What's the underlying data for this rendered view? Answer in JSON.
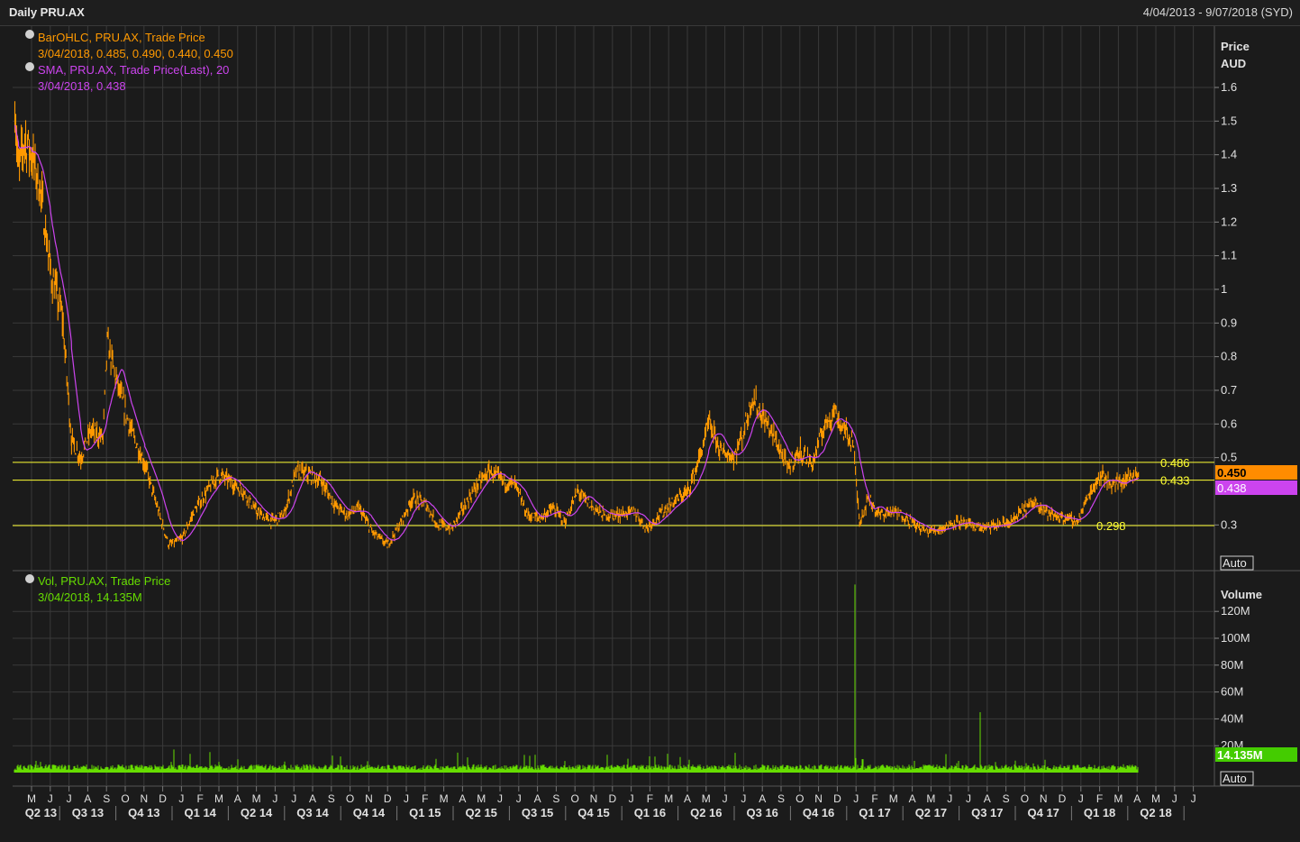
{
  "header": {
    "title": "Daily PRU.AX",
    "date_range": "4/04/2013 - 9/07/2018 (SYD)"
  },
  "legend": {
    "ohlc_name": "BarOHLC, PRU.AX, Trade Price",
    "ohlc_values": "3/04/2018, 0.485, 0.490, 0.440, 0.450",
    "sma_name": "SMA, PRU.AX, Trade Price(Last),  20",
    "sma_values": "3/04/2018, 0.438",
    "vol_name": "Vol, PRU.AX, Trade Price",
    "vol_values": "3/04/2018, 14.135M"
  },
  "price_axis": {
    "title_line1": "Price",
    "title_line2": "AUD",
    "ticks": [
      "1.6",
      "1.5",
      "1.4",
      "1.3",
      "1.2",
      "1.1",
      "1",
      "0.9",
      "0.8",
      "0.7",
      "0.6",
      "0.5",
      "0.3"
    ],
    "tick_values": [
      1.6,
      1.5,
      1.4,
      1.3,
      1.2,
      1.1,
      1.0,
      0.9,
      0.8,
      0.7,
      0.6,
      0.5,
      0.3
    ],
    "last_price": "0.450",
    "last_sma": "0.438",
    "auto_label": "Auto"
  },
  "volume_axis": {
    "title": "Volume",
    "ticks": [
      "120M",
      "100M",
      "80M",
      "60M",
      "40M",
      "20M"
    ],
    "tick_values": [
      120,
      100,
      80,
      60,
      40,
      20
    ],
    "last_volume": "14.135M",
    "auto_label": "Auto"
  },
  "levels": [
    {
      "label": "0.486",
      "value": 0.486
    },
    {
      "label": "0.433",
      "value": 0.433
    },
    {
      "label": "0.298",
      "value": 0.298
    }
  ],
  "x_axis": {
    "months": [
      "M",
      "J",
      "J",
      "A",
      "S",
      "O",
      "N",
      "D",
      "J",
      "F",
      "M",
      "A",
      "M",
      "J",
      "J",
      "A",
      "S",
      "O",
      "N",
      "D",
      "J",
      "F",
      "M",
      "A",
      "M",
      "J",
      "J",
      "A",
      "S",
      "O",
      "N",
      "D",
      "J",
      "F",
      "M",
      "A",
      "M",
      "J",
      "J",
      "A",
      "S",
      "O",
      "N",
      "D",
      "J",
      "F",
      "M",
      "A",
      "M",
      "J",
      "J",
      "A",
      "S",
      "O",
      "N",
      "D",
      "J",
      "F",
      "M",
      "A",
      "M",
      "J",
      "J"
    ],
    "quarters": [
      "Q2 13",
      "Q3 13",
      "Q4 13",
      "Q1 14",
      "Q2 14",
      "Q3 14",
      "Q4 14",
      "Q1 15",
      "Q2 15",
      "Q3 15",
      "Q4 15",
      "Q1 16",
      "Q2 16",
      "Q3 16",
      "Q4 16",
      "Q1 17",
      "Q2 17",
      "Q3 17",
      "Q4 17",
      "Q1 18",
      "Q2 18"
    ]
  },
  "colors": {
    "background": "#1b1b1b",
    "grid": "#3a3a3a",
    "price": "#ff9900",
    "sma": "#cc44ee",
    "volume": "#66dd00",
    "level": "#ffff33",
    "text": "#e0e0e0"
  },
  "chart_data": {
    "type": "line",
    "title": "Daily PRU.AX",
    "x_range": [
      "2013-04-04",
      "2018-07-09"
    ],
    "ylim": [
      0.2,
      1.7
    ],
    "price_series_name": "BarOHLC, PRU.AX, Trade Price",
    "sma_series_name": "SMA, PRU.AX, Trade Price(Last),  20",
    "price_points": [
      {
        "x": "2013-04-04",
        "y": 1.55
      },
      {
        "x": "2013-04-10",
        "y": 1.35
      },
      {
        "x": "2013-04-20",
        "y": 1.45
      },
      {
        "x": "2013-05-01",
        "y": 1.4
      },
      {
        "x": "2013-05-15",
        "y": 1.3
      },
      {
        "x": "2013-06-01",
        "y": 1.05
      },
      {
        "x": "2013-06-20",
        "y": 0.92
      },
      {
        "x": "2013-07-05",
        "y": 0.55
      },
      {
        "x": "2013-07-20",
        "y": 0.5
      },
      {
        "x": "2013-08-05",
        "y": 0.58
      },
      {
        "x": "2013-08-25",
        "y": 0.56
      },
      {
        "x": "2013-09-01",
        "y": 0.84
      },
      {
        "x": "2013-09-20",
        "y": 0.7
      },
      {
        "x": "2013-10-10",
        "y": 0.58
      },
      {
        "x": "2013-11-01",
        "y": 0.48
      },
      {
        "x": "2013-11-20",
        "y": 0.36
      },
      {
        "x": "2013-12-10",
        "y": 0.24
      },
      {
        "x": "2014-01-01",
        "y": 0.26
      },
      {
        "x": "2014-01-20",
        "y": 0.34
      },
      {
        "x": "2014-02-10",
        "y": 0.4
      },
      {
        "x": "2014-03-01",
        "y": 0.45
      },
      {
        "x": "2014-03-20",
        "y": 0.43
      },
      {
        "x": "2014-04-10",
        "y": 0.4
      },
      {
        "x": "2014-05-01",
        "y": 0.34
      },
      {
        "x": "2014-05-25",
        "y": 0.31
      },
      {
        "x": "2014-06-15",
        "y": 0.33
      },
      {
        "x": "2014-07-05",
        "y": 0.46
      },
      {
        "x": "2014-07-25",
        "y": 0.45
      },
      {
        "x": "2014-08-15",
        "y": 0.43
      },
      {
        "x": "2014-09-05",
        "y": 0.36
      },
      {
        "x": "2014-09-25",
        "y": 0.33
      },
      {
        "x": "2014-10-15",
        "y": 0.35
      },
      {
        "x": "2014-11-05",
        "y": 0.28
      },
      {
        "x": "2014-11-30",
        "y": 0.24
      },
      {
        "x": "2014-12-20",
        "y": 0.3
      },
      {
        "x": "2015-01-10",
        "y": 0.38
      },
      {
        "x": "2015-02-01",
        "y": 0.36
      },
      {
        "x": "2015-02-20",
        "y": 0.3
      },
      {
        "x": "2015-03-15",
        "y": 0.29
      },
      {
        "x": "2015-04-05",
        "y": 0.36
      },
      {
        "x": "2015-04-25",
        "y": 0.42
      },
      {
        "x": "2015-05-15",
        "y": 0.46
      },
      {
        "x": "2015-06-05",
        "y": 0.43
      },
      {
        "x": "2015-06-25",
        "y": 0.42
      },
      {
        "x": "2015-07-15",
        "y": 0.33
      },
      {
        "x": "2015-08-05",
        "y": 0.32
      },
      {
        "x": "2015-08-25",
        "y": 0.35
      },
      {
        "x": "2015-09-15",
        "y": 0.31
      },
      {
        "x": "2015-10-05",
        "y": 0.4
      },
      {
        "x": "2015-10-25",
        "y": 0.36
      },
      {
        "x": "2015-11-15",
        "y": 0.33
      },
      {
        "x": "2015-12-10",
        "y": 0.33
      },
      {
        "x": "2016-01-05",
        "y": 0.34
      },
      {
        "x": "2016-01-25",
        "y": 0.29
      },
      {
        "x": "2016-02-15",
        "y": 0.33
      },
      {
        "x": "2016-03-10",
        "y": 0.37
      },
      {
        "x": "2016-04-01",
        "y": 0.4
      },
      {
        "x": "2016-04-20",
        "y": 0.5
      },
      {
        "x": "2016-05-05",
        "y": 0.6
      },
      {
        "x": "2016-05-25",
        "y": 0.52
      },
      {
        "x": "2016-06-15",
        "y": 0.5
      },
      {
        "x": "2016-07-01",
        "y": 0.58
      },
      {
        "x": "2016-07-15",
        "y": 0.68
      },
      {
        "x": "2016-08-01",
        "y": 0.62
      },
      {
        "x": "2016-08-20",
        "y": 0.56
      },
      {
        "x": "2016-09-10",
        "y": 0.47
      },
      {
        "x": "2016-10-01",
        "y": 0.52
      },
      {
        "x": "2016-10-20",
        "y": 0.48
      },
      {
        "x": "2016-11-10",
        "y": 0.6
      },
      {
        "x": "2016-11-25",
        "y": 0.64
      },
      {
        "x": "2016-12-10",
        "y": 0.58
      },
      {
        "x": "2016-12-25",
        "y": 0.55
      },
      {
        "x": "2017-01-05",
        "y": 0.31
      },
      {
        "x": "2017-01-20",
        "y": 0.38
      },
      {
        "x": "2017-02-05",
        "y": 0.33
      },
      {
        "x": "2017-02-25",
        "y": 0.34
      },
      {
        "x": "2017-03-15",
        "y": 0.33
      },
      {
        "x": "2017-04-05",
        "y": 0.3
      },
      {
        "x": "2017-04-25",
        "y": 0.28
      },
      {
        "x": "2017-05-20",
        "y": 0.29
      },
      {
        "x": "2017-06-10",
        "y": 0.31
      },
      {
        "x": "2017-07-01",
        "y": 0.3
      },
      {
        "x": "2017-07-25",
        "y": 0.29
      },
      {
        "x": "2017-08-20",
        "y": 0.3
      },
      {
        "x": "2017-09-10",
        "y": 0.31
      },
      {
        "x": "2017-10-01",
        "y": 0.35
      },
      {
        "x": "2017-10-20",
        "y": 0.37
      },
      {
        "x": "2017-11-10",
        "y": 0.33
      },
      {
        "x": "2017-12-05",
        "y": 0.32
      },
      {
        "x": "2017-12-25",
        "y": 0.31
      },
      {
        "x": "2018-01-15",
        "y": 0.4
      },
      {
        "x": "2018-02-01",
        "y": 0.45
      },
      {
        "x": "2018-02-20",
        "y": 0.42
      },
      {
        "x": "2018-03-10",
        "y": 0.43
      },
      {
        "x": "2018-03-25",
        "y": 0.45
      },
      {
        "x": "2018-04-03",
        "y": 0.45
      }
    ],
    "volume_points": [
      {
        "x": "2013-06-01",
        "y": 3
      },
      {
        "x": "2013-09-01",
        "y": 4
      },
      {
        "x": "2014-01-01",
        "y": 6
      },
      {
        "x": "2014-03-01",
        "y": 8
      },
      {
        "x": "2014-06-01",
        "y": 4
      },
      {
        "x": "2014-09-01",
        "y": 3
      },
      {
        "x": "2015-01-01",
        "y": 4
      },
      {
        "x": "2015-06-01",
        "y": 3
      },
      {
        "x": "2015-10-01",
        "y": 3
      },
      {
        "x": "2016-02-01",
        "y": 2
      },
      {
        "x": "2016-06-01",
        "y": 4
      },
      {
        "x": "2016-09-01",
        "y": 3
      },
      {
        "x": "2016-12-01",
        "y": 4
      },
      {
        "x": "2016-12-28",
        "y": 140
      },
      {
        "x": "2017-01-10",
        "y": 10
      },
      {
        "x": "2017-05-01",
        "y": 5
      },
      {
        "x": "2017-07-20",
        "y": 45
      },
      {
        "x": "2017-10-01",
        "y": 3
      },
      {
        "x": "2018-01-15",
        "y": 4
      },
      {
        "x": "2018-04-03",
        "y": 14.135
      }
    ]
  }
}
